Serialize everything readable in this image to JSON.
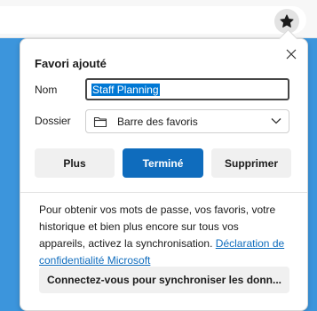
{
  "dialog": {
    "title": "Favori ajouté",
    "name_label": "Nom",
    "name_value": "Staff Planning",
    "folder_label": "Dossier",
    "folder_value": "Barre des favoris"
  },
  "buttons": {
    "more": "Plus",
    "done": "Terminé",
    "delete": "Supprimer"
  },
  "sync": {
    "message": "Pour obtenir vos mots de passe, vos favoris, votre historique et bien plus encore sur tous vos appareils, activez la synchronisation.",
    "privacy_link": "Déclaration de confidentialité Microsoft",
    "signin_button": "Connectez-vous pour synchroniser les donn..."
  },
  "colors": {
    "accent": "#0f6cbd",
    "page_background": "#3c95dc"
  },
  "icons": [
    "star-filled-icon",
    "close-icon",
    "folder-icon",
    "chevron-down-icon"
  ]
}
